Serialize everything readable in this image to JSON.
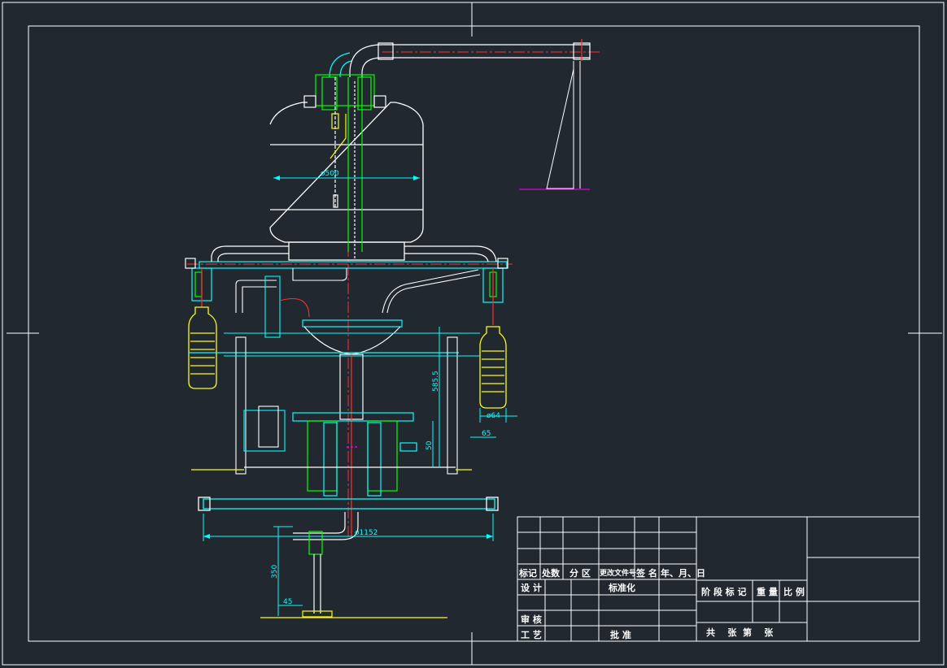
{
  "drawing": {
    "dimensions": {
      "tank_diameter": "ø500",
      "frame_diameter": "ø1152",
      "height_585": "585.5",
      "height_50": "50",
      "bottle_diameter": "ø64",
      "offset_65": "65",
      "stand_height": "350",
      "angle_45": "45"
    }
  },
  "title_block": {
    "col_mark": "标记",
    "col_count": "处数",
    "col_zone": "分 区",
    "col_doc": "更改文件号",
    "col_sign": "签 名",
    "col_date": "年、月、日",
    "design": "设 计",
    "standardize": "标准化",
    "stage_mark": "阶 段 标 记",
    "weight": "重 量",
    "scale": "比 例",
    "review": "审 核",
    "process": "工 艺",
    "approve": "批 准",
    "sheets": "共    张  第    张"
  },
  "colors": {
    "background": "#212830",
    "frame": "#ffffff",
    "cyan": "#00ffff",
    "green": "#00ff00",
    "yellow": "#ffff00",
    "red": "#ff3030",
    "magenta": "#ff00ff"
  }
}
